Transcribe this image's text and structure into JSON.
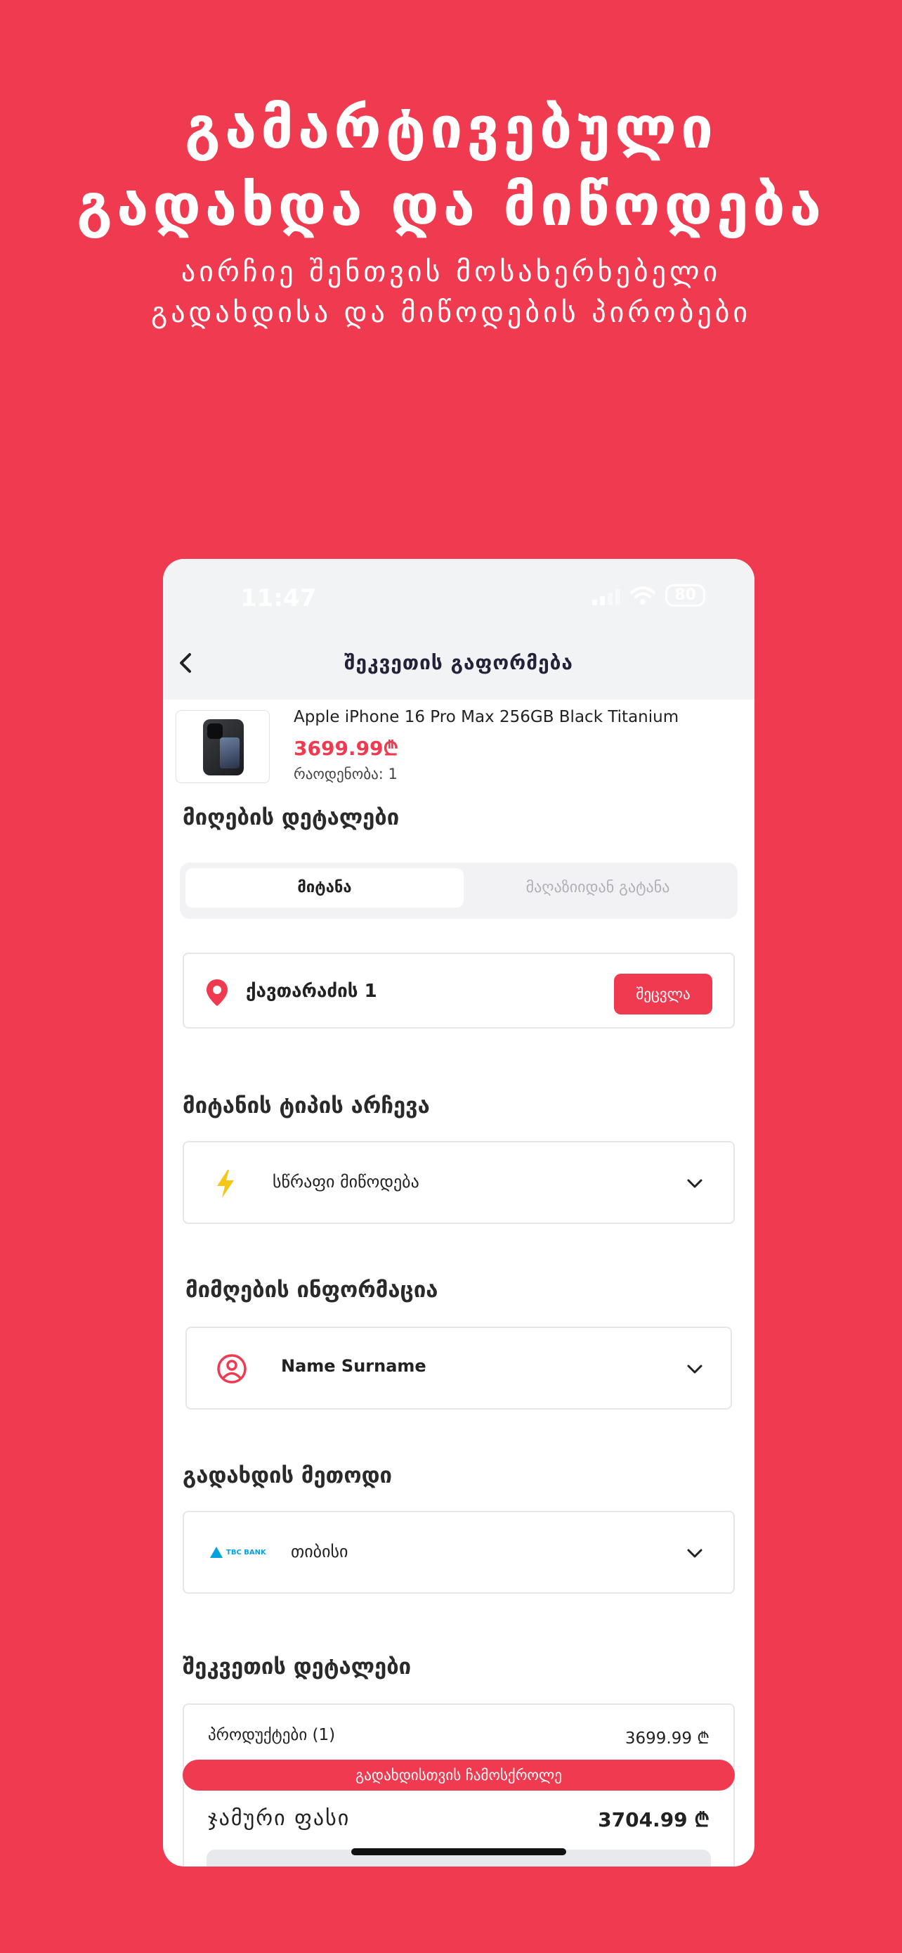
{
  "hero": {
    "title_line1": "გამარტივებული",
    "title_line2": "გადახდა და მიწოდება",
    "subtitle_line1": "აირჩიე შენთვის მოსახერხებელი",
    "subtitle_line2": "გადახდისა და მიწოდების პირობები"
  },
  "status_bar": {
    "time": "11:47",
    "battery": "80"
  },
  "header": {
    "title": "შეკვეთის გაფორმება"
  },
  "product": {
    "name": "Apple iPhone 16 Pro Max 256GB Black Titanium",
    "price": "3699.99₾",
    "quantity": "რაოდენობა: 1"
  },
  "receive": {
    "title": "მიღების დეტალები",
    "tab_delivery": "მიტანა",
    "tab_pickup": "მაღაზიიდან გატანა",
    "address": "ქავთარაძის 1",
    "change_label": "შეცვლა"
  },
  "delivery_type": {
    "title": "მიტანის ტიპის არჩევა",
    "value": "სწრაფი მიწოდება"
  },
  "recipient": {
    "title": "მიმღების ინფორმაცია",
    "value": "Name Surname"
  },
  "payment": {
    "title": "გადახდის მეთოდი",
    "bank_logo": "TBC BANK",
    "value": "თიბისი"
  },
  "order": {
    "title": "შეკვეთის დეტალები",
    "products_label": "პროდუქტები (1)",
    "products_value": "3699.99 ₾",
    "pill": "გადახდისთვის ჩამოსქროლე",
    "total_label": "ჯამური ფასი",
    "total_value": "3704.99 ₾"
  },
  "colors": {
    "brand": "#ef3a50",
    "accent_yellow": "#f5c518"
  }
}
